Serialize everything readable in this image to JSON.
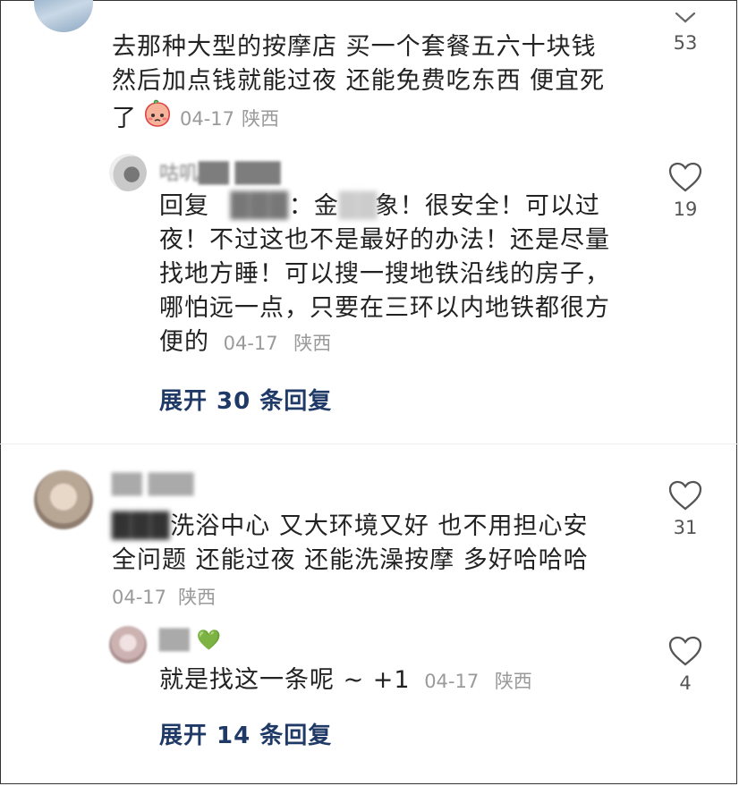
{
  "comments": [
    {
      "text_line1": "去那种大型的按摩店 买一个套餐五六十块钱",
      "text_line2": "然后加点钱就能过夜 还能免费吃东西 便宜死",
      "text_line3": "了",
      "emoji": "peach-face",
      "date": "04-17",
      "location": "陕西",
      "likes": "53"
    },
    {
      "username": "咕叽██ ███",
      "reply_prefix": "回复",
      "reply_target": "███",
      "text_line1_a": "：金",
      "text_line1_b": "象！很安全！可以过",
      "text_line2": "夜！不过这也不是最好的办法！还是尽量",
      "text_line3": "找地方睡！可以搜一搜地铁沿线的房子，",
      "text_line4": "哪怕远一点，只要在三环以内地铁都很方",
      "text_line5": "便的",
      "date": "04-17",
      "location": "陕西",
      "likes": "19",
      "expand_label": "展开 30 条回复"
    },
    {
      "username": "██ ███",
      "text_line1_prefix": "███",
      "text_line1": "洗浴中心 又大环境又好 也不用担心安",
      "text_line2": "全问题 还能过夜 还能洗澡按摩 多好哈哈哈",
      "date": "04-17",
      "location": "陕西",
      "likes": "31"
    },
    {
      "username": "██",
      "username_emoji": "💚",
      "text": "就是找这一条呢 ~ +1",
      "date": "04-17",
      "location": "陕西",
      "likes": "4",
      "expand_label": "展开 14 条回复"
    }
  ],
  "colors": {
    "link": "#1f3a66",
    "meta": "#9a9a9a",
    "text": "#222222"
  }
}
